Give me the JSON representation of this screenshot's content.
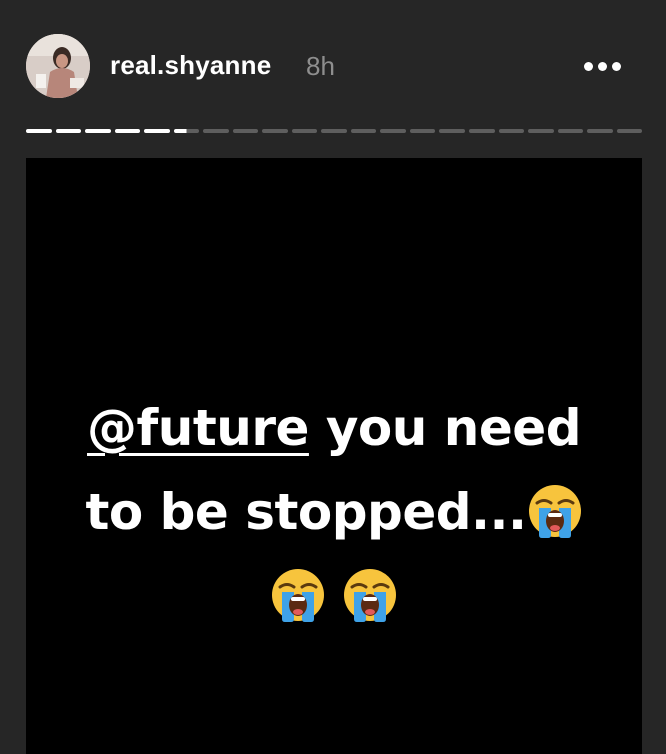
{
  "story": {
    "username": "real.shyanne",
    "timestamp": "8h",
    "progress": {
      "total_segments": 21,
      "seen_segments": 5,
      "current_segment_fill": 0.5
    },
    "text": {
      "mention": "@future",
      "line1_rest": " you need",
      "line2": "to be stopped...",
      "emoji_name": "loudly-crying-face-emoji"
    }
  },
  "colors": {
    "background": "#262626",
    "story_bg": "#000000",
    "text": "#ffffff",
    "timestamp": "#8e8e8e",
    "progress_seen": "#ffffff",
    "progress_unseen": "#5e5e5e",
    "emoji_face": "#f7c43d",
    "emoji_tears": "#3fa2e8"
  }
}
